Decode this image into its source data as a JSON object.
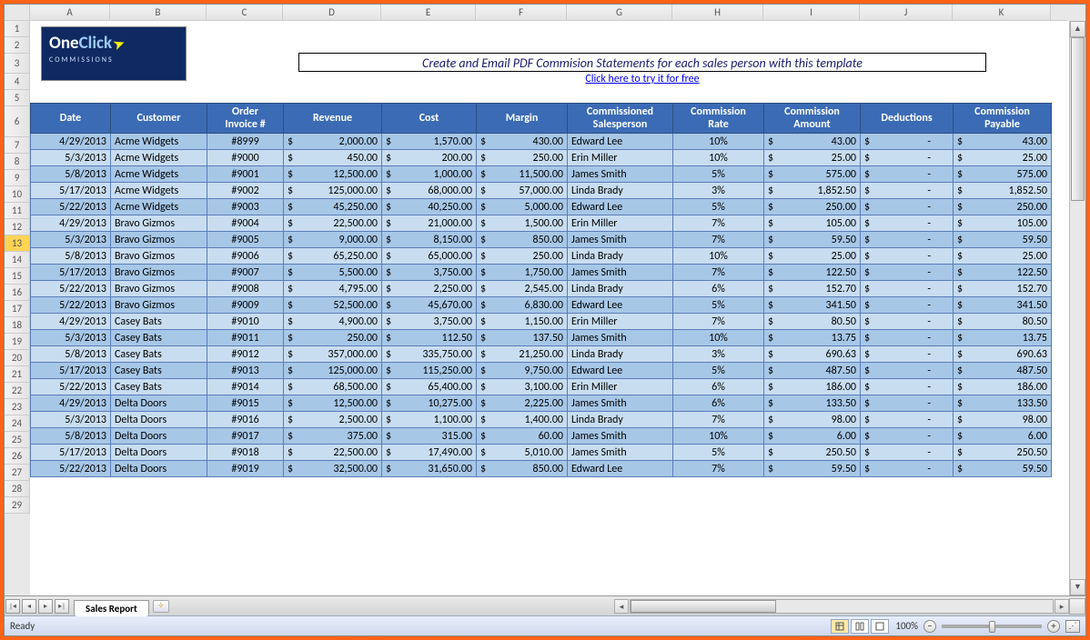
{
  "logo": {
    "text1": "One",
    "text2": "Click",
    "sub": "COMMISSIONS"
  },
  "banner": "Create and Email PDF Commision Statements for each sales person with this template",
  "try_link": "Click here to try it for free",
  "columns_letters": [
    "A",
    "B",
    "C",
    "D",
    "E",
    "F",
    "G",
    "H",
    "I",
    "J",
    "K"
  ],
  "row_numbers": [
    1,
    2,
    3,
    4,
    5,
    6,
    7,
    8,
    9,
    10,
    11,
    12,
    13,
    14,
    15,
    16,
    17,
    18,
    19,
    20,
    21,
    22,
    23,
    24,
    25,
    26,
    27,
    28,
    29
  ],
  "selected_row": 13,
  "headers": [
    "Date",
    "Customer",
    "Order / Invoice #",
    "Revenue",
    "Cost",
    "Margin",
    "Commissioned Salesperson",
    "Commission Rate",
    "Commission Amount",
    "Deductions",
    "Commission Payable"
  ],
  "rows": [
    {
      "date": "4/29/2013",
      "customer": "Acme Widgets",
      "order": "#8999",
      "revenue": "2,000.00",
      "cost": "1,570.00",
      "margin": "430.00",
      "sp": "Edward Lee",
      "rate": "10%",
      "amount": "43.00",
      "ded": "-",
      "pay": "43.00"
    },
    {
      "date": "5/3/2013",
      "customer": "Acme Widgets",
      "order": "#9000",
      "revenue": "450.00",
      "cost": "200.00",
      "margin": "250.00",
      "sp": "Erin Miller",
      "rate": "10%",
      "amount": "25.00",
      "ded": "-",
      "pay": "25.00"
    },
    {
      "date": "5/8/2013",
      "customer": "Acme Widgets",
      "order": "#9001",
      "revenue": "12,500.00",
      "cost": "1,000.00",
      "margin": "11,500.00",
      "sp": "James Smith",
      "rate": "5%",
      "amount": "575.00",
      "ded": "-",
      "pay": "575.00"
    },
    {
      "date": "5/17/2013",
      "customer": "Acme Widgets",
      "order": "#9002",
      "revenue": "125,000.00",
      "cost": "68,000.00",
      "margin": "57,000.00",
      "sp": "Linda Brady",
      "rate": "3%",
      "amount": "1,852.50",
      "ded": "-",
      "pay": "1,852.50"
    },
    {
      "date": "5/22/2013",
      "customer": "Acme Widgets",
      "order": "#9003",
      "revenue": "45,250.00",
      "cost": "40,250.00",
      "margin": "5,000.00",
      "sp": "Edward Lee",
      "rate": "5%",
      "amount": "250.00",
      "ded": "-",
      "pay": "250.00"
    },
    {
      "date": "4/29/2013",
      "customer": "Bravo Gizmos",
      "order": "#9004",
      "revenue": "22,500.00",
      "cost": "21,000.00",
      "margin": "1,500.00",
      "sp": "Erin Miller",
      "rate": "7%",
      "amount": "105.00",
      "ded": "-",
      "pay": "105.00"
    },
    {
      "date": "5/3/2013",
      "customer": "Bravo Gizmos",
      "order": "#9005",
      "revenue": "9,000.00",
      "cost": "8,150.00",
      "margin": "850.00",
      "sp": "James Smith",
      "rate": "7%",
      "amount": "59.50",
      "ded": "-",
      "pay": "59.50"
    },
    {
      "date": "5/8/2013",
      "customer": "Bravo Gizmos",
      "order": "#9006",
      "revenue": "65,250.00",
      "cost": "65,000.00",
      "margin": "250.00",
      "sp": "Linda Brady",
      "rate": "10%",
      "amount": "25.00",
      "ded": "-",
      "pay": "25.00"
    },
    {
      "date": "5/17/2013",
      "customer": "Bravo Gizmos",
      "order": "#9007",
      "revenue": "5,500.00",
      "cost": "3,750.00",
      "margin": "1,750.00",
      "sp": "James Smith",
      "rate": "7%",
      "amount": "122.50",
      "ded": "-",
      "pay": "122.50"
    },
    {
      "date": "5/22/2013",
      "customer": "Bravo Gizmos",
      "order": "#9008",
      "revenue": "4,795.00",
      "cost": "2,250.00",
      "margin": "2,545.00",
      "sp": "Linda Brady",
      "rate": "6%",
      "amount": "152.70",
      "ded": "-",
      "pay": "152.70"
    },
    {
      "date": "5/22/2013",
      "customer": "Bravo Gizmos",
      "order": "#9009",
      "revenue": "52,500.00",
      "cost": "45,670.00",
      "margin": "6,830.00",
      "sp": "Edward Lee",
      "rate": "5%",
      "amount": "341.50",
      "ded": "-",
      "pay": "341.50"
    },
    {
      "date": "4/29/2013",
      "customer": "Casey Bats",
      "order": "#9010",
      "revenue": "4,900.00",
      "cost": "3,750.00",
      "margin": "1,150.00",
      "sp": "Erin Miller",
      "rate": "7%",
      "amount": "80.50",
      "ded": "-",
      "pay": "80.50"
    },
    {
      "date": "5/3/2013",
      "customer": "Casey Bats",
      "order": "#9011",
      "revenue": "250.00",
      "cost": "112.50",
      "margin": "137.50",
      "sp": "James Smith",
      "rate": "10%",
      "amount": "13.75",
      "ded": "-",
      "pay": "13.75"
    },
    {
      "date": "5/8/2013",
      "customer": "Casey Bats",
      "order": "#9012",
      "revenue": "357,000.00",
      "cost": "335,750.00",
      "margin": "21,250.00",
      "sp": "Linda Brady",
      "rate": "3%",
      "amount": "690.63",
      "ded": "-",
      "pay": "690.63"
    },
    {
      "date": "5/17/2013",
      "customer": "Casey Bats",
      "order": "#9013",
      "revenue": "125,000.00",
      "cost": "115,250.00",
      "margin": "9,750.00",
      "sp": "Edward Lee",
      "rate": "5%",
      "amount": "487.50",
      "ded": "-",
      "pay": "487.50"
    },
    {
      "date": "5/22/2013",
      "customer": "Casey Bats",
      "order": "#9014",
      "revenue": "68,500.00",
      "cost": "65,400.00",
      "margin": "3,100.00",
      "sp": "Erin Miller",
      "rate": "6%",
      "amount": "186.00",
      "ded": "-",
      "pay": "186.00"
    },
    {
      "date": "4/29/2013",
      "customer": "Delta Doors",
      "order": "#9015",
      "revenue": "12,500.00",
      "cost": "10,275.00",
      "margin": "2,225.00",
      "sp": "James Smith",
      "rate": "6%",
      "amount": "133.50",
      "ded": "-",
      "pay": "133.50"
    },
    {
      "date": "5/3/2013",
      "customer": "Delta Doors",
      "order": "#9016",
      "revenue": "2,500.00",
      "cost": "1,100.00",
      "margin": "1,400.00",
      "sp": "Linda Brady",
      "rate": "7%",
      "amount": "98.00",
      "ded": "-",
      "pay": "98.00"
    },
    {
      "date": "5/8/2013",
      "customer": "Delta Doors",
      "order": "#9017",
      "revenue": "375.00",
      "cost": "315.00",
      "margin": "60.00",
      "sp": "James Smith",
      "rate": "10%",
      "amount": "6.00",
      "ded": "-",
      "pay": "6.00"
    },
    {
      "date": "5/17/2013",
      "customer": "Delta Doors",
      "order": "#9018",
      "revenue": "22,500.00",
      "cost": "17,490.00",
      "margin": "5,010.00",
      "sp": "James Smith",
      "rate": "5%",
      "amount": "250.50",
      "ded": "-",
      "pay": "250.50"
    },
    {
      "date": "5/22/2013",
      "customer": "Delta Doors",
      "order": "#9019",
      "revenue": "32,500.00",
      "cost": "31,650.00",
      "margin": "850.00",
      "sp": "Edward Lee",
      "rate": "7%",
      "amount": "59.50",
      "ded": "-",
      "pay": "59.50"
    }
  ],
  "sheet_tab": "Sales Report",
  "status": {
    "ready": "Ready",
    "zoom": "100%"
  }
}
